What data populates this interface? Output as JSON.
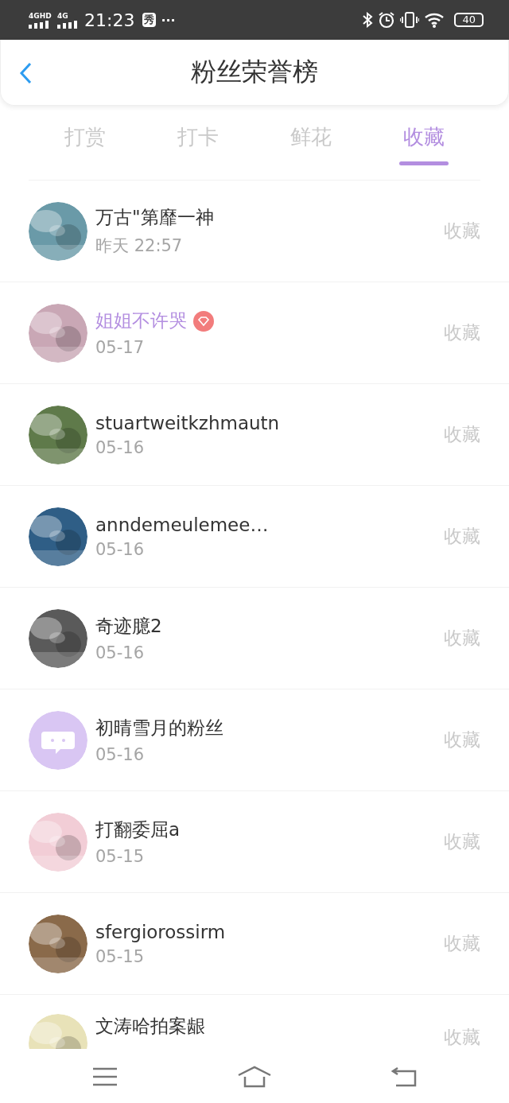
{
  "status_bar": {
    "network_1": "4GHD",
    "network_2": "4G",
    "time": "21:23",
    "app_badge": "秀",
    "more": "···",
    "battery": "40"
  },
  "header": {
    "title": "粉丝荣誉榜"
  },
  "tabs": [
    {
      "label": "打赏",
      "selected": false
    },
    {
      "label": "打卡",
      "selected": false
    },
    {
      "label": "鲜花",
      "selected": false
    },
    {
      "label": "收藏",
      "selected": true
    }
  ],
  "rows": [
    {
      "name": "万古\"第靡一神",
      "date": "昨天 22:57",
      "action": "收藏",
      "vip": false,
      "kind": "picture"
    },
    {
      "name": "姐姐不许哭",
      "date": "05-17",
      "action": "收藏",
      "vip": true,
      "kind": "picture"
    },
    {
      "name": "stuartweitkzhmautn",
      "date": "05-16",
      "action": "收藏",
      "vip": false,
      "kind": "picture"
    },
    {
      "name": "anndemeulemee…",
      "date": "05-16",
      "action": "收藏",
      "vip": false,
      "kind": "picture"
    },
    {
      "name": "奇迹臆2",
      "date": "05-16",
      "action": "收藏",
      "vip": false,
      "kind": "picture"
    },
    {
      "name": "初晴雪月的粉丝",
      "date": "05-16",
      "action": "收藏",
      "vip": false,
      "kind": "default"
    },
    {
      "name": "打翻委屈a",
      "date": "05-15",
      "action": "收藏",
      "vip": false,
      "kind": "picture"
    },
    {
      "name": "sfergiorossirm",
      "date": "05-15",
      "action": "收藏",
      "vip": false,
      "kind": "picture"
    },
    {
      "name": "文涛哈拍案龈",
      "action": "收藏",
      "vip": false,
      "kind": "picture"
    }
  ]
}
